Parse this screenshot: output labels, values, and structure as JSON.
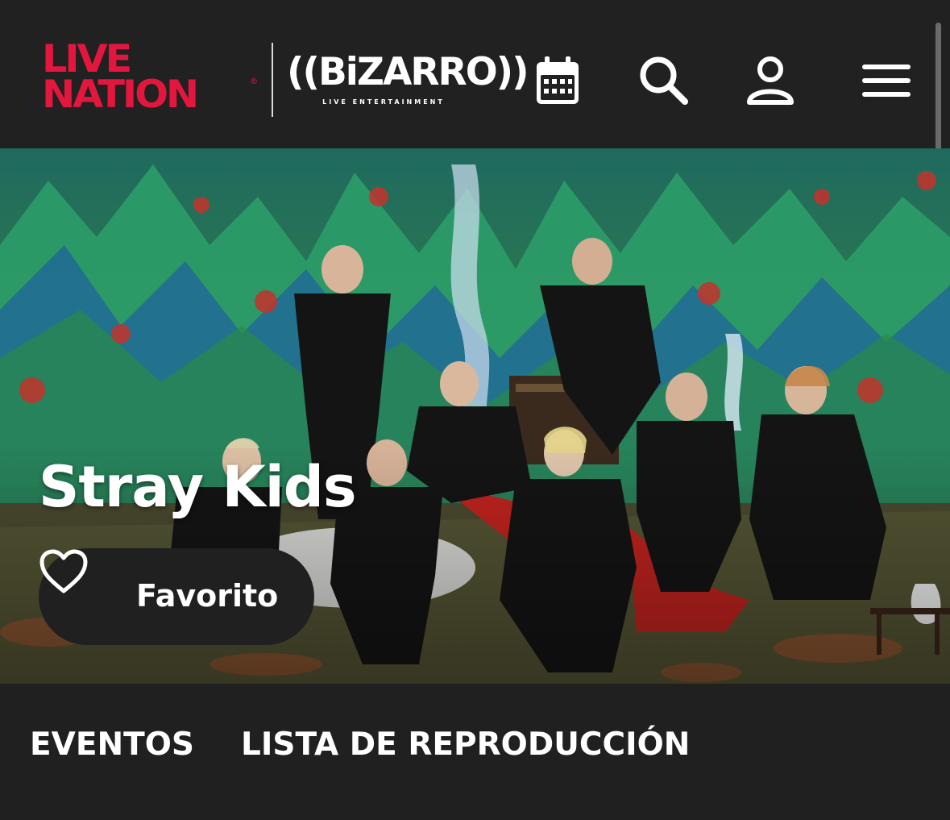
{
  "header": {
    "livenation_logo_line1": "LIVE",
    "livenation_logo_line2": "NATION",
    "livenation_registered": "®",
    "bizarro_logo": "((BiZARRO))",
    "bizarro_subtitle": "LIVE ENTERTAINMENT",
    "icons": [
      "calendar-icon",
      "search-icon",
      "user-icon",
      "menu-icon"
    ]
  },
  "hero": {
    "title": "Stray Kids",
    "favorite_label": "Favorito"
  },
  "tabs": [
    {
      "label": "EVENTOS"
    },
    {
      "label": "LISTA DE REPRODUCCIÓN"
    }
  ],
  "colors": {
    "background": "#1f1f1f",
    "livenation_red": "#e3173e",
    "text": "#ffffff",
    "button_bg": "#202020"
  }
}
